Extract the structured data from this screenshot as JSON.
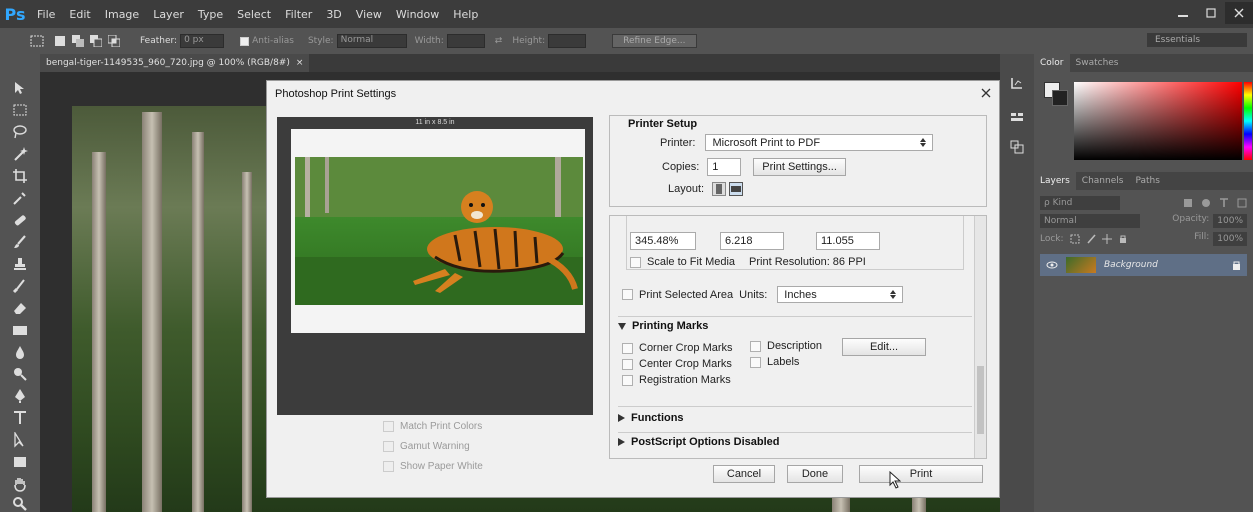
{
  "app": {
    "logo": "Ps",
    "min": "–",
    "restore": "&#x25A1;",
    "close": "✕"
  },
  "menu": [
    "File",
    "Edit",
    "Image",
    "Layer",
    "Type",
    "Select",
    "Filter",
    "3D",
    "View",
    "Window",
    "Help"
  ],
  "options": {
    "feather_label": "Feather:",
    "feather_value": "0 px",
    "antialias": "Anti-alias",
    "style_label": "Style:",
    "style_value": "Normal",
    "width_label": "Width:",
    "height_label": "Height:",
    "refine_edge": "Refine Edge...",
    "workspace": "Essentials"
  },
  "document": {
    "tab_title": "bengal-tiger-1149535_960_720.jpg @ 100% (RGB/8#)",
    "tab_close": "×"
  },
  "panels": {
    "color_tabs": [
      "Color",
      "Swatches"
    ],
    "layers_tabs": [
      "Layers",
      "Channels",
      "Paths"
    ],
    "kind": "ρ Kind",
    "blend_mode": "Normal",
    "opacity_label": "Opacity:",
    "opacity_value": "100%",
    "lock_label": "Lock:",
    "fill_label": "Fill:",
    "fill_value": "100%",
    "layer_name": "Background"
  },
  "dialog": {
    "title": "Photoshop Print Settings",
    "close": "×",
    "paper_size": "11 in x 8.5 in",
    "match_print_colors": "Match Print Colors",
    "gamut_warning": "Gamut Warning",
    "show_paper_white": "Show Paper White",
    "printer_setup_title": "Printer Setup",
    "printer_label": "Printer:",
    "printer_value": "Microsoft Print to PDF",
    "copies_label": "Copies:",
    "copies_value": "1",
    "print_settings_button": "Print Settings...",
    "layout_label": "Layout:",
    "scale_value": "345.48%",
    "height_value": "6.218",
    "width_value": "11.055",
    "scale_to_fit": "Scale to Fit Media",
    "print_resolution": "Print Resolution: 86 PPI",
    "print_selected_area": "Print Selected Area",
    "units_label": "Units:",
    "units_value": "Inches",
    "printing_marks_title": "Printing Marks",
    "corner_crop_marks": "Corner Crop Marks",
    "center_crop_marks": "Center Crop Marks",
    "registration_marks": "Registration Marks",
    "description": "Description",
    "labels": "Labels",
    "edit_button": "Edit...",
    "functions_title": "Functions",
    "postscript_title": "PostScript Options Disabled",
    "cancel_button": "Cancel",
    "done_button": "Done",
    "print_button": "Print"
  },
  "colors": {
    "ps_blue": "#31a8ff",
    "layer_selected": "#5f6f86",
    "dialog_bg": "#f0f0f0"
  }
}
